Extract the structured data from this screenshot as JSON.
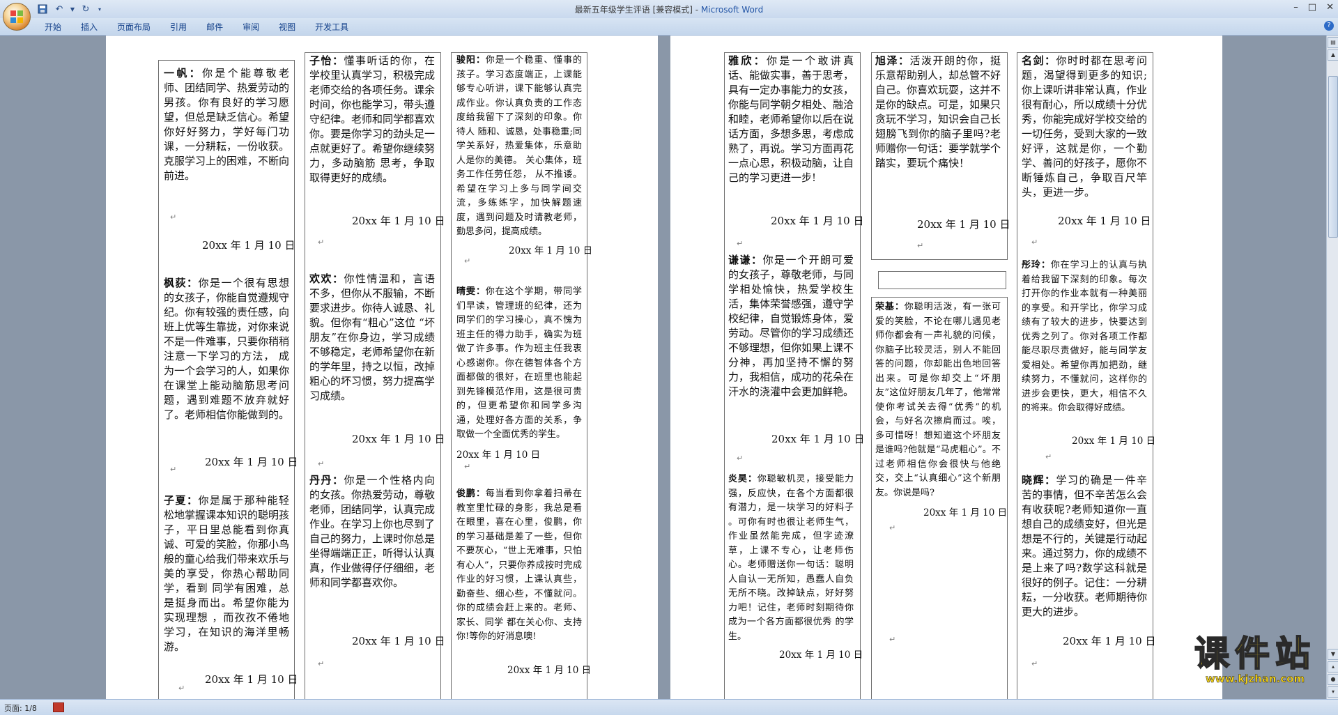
{
  "window": {
    "doc_title": "最新五年级学生评语 [兼容模式] - ",
    "app_name": "Microsoft Word"
  },
  "ribbon": {
    "tabs": [
      "开始",
      "插入",
      "页面布局",
      "引用",
      "邮件",
      "审阅",
      "视图",
      "开发工具"
    ]
  },
  "status": {
    "page": "页面: 1/8"
  },
  "watermark": {
    "text": "课件站",
    "url": "www.kjzhan.com"
  },
  "entries": {
    "yifan": {
      "name": "一帆：",
      "text": "你是个能尊敬老师、团结同学、热爱劳动的男孩。你有良好的学习愿望，但总是缺乏信心。希望你好好努力，学好每门功课，一分耕耘，一份收获。克服学习上的困难，不断向前进。",
      "date": "20xx 年 1 月 10 日"
    },
    "fengrong": {
      "name": "枫荻：",
      "text": "你是一个很有思想的女孩子，你能自觉遵规守纪。你有较强的责任感，向班上优等生靠拢，对你来说不是一件难事，只要你稍稍注意一下学习的方法， 成为一个会学习的人，如果你在课堂上能动脑筋思考问题，遇到难题不放弃就好了。老师相信你能做到的。",
      "date": "20xx 年 1 月 10 日"
    },
    "zixia": {
      "name": "子夏：",
      "text": "你是属于那种能轻松地掌握课本知识的聪明孩子，平日里总能看到你真诚、可爱的笑脸，你那小鸟般的童心给我们带来欢乐与美的享受，你热心帮助同学，看到 同学有困难，总是挺身而出。希望你能为 实现理想 ，而孜孜不倦地学习，在知识的海洋里畅游。",
      "date": "20xx 年 1 月 10 日"
    },
    "ziyi": {
      "name": "子怡：",
      "text": "懂事听话的你，在学校里认真学习，积极完成老师交给的各项任务。课余时间，你也能学习，带头遵守纪律。老师和同学都喜欢你。要是你学习的劲头足一点就更好了。希望你继续努力，多动脑筋 思考，争取取得更好的成绩。",
      "date": "20xx 年 1 月 10 日"
    },
    "huanhuan": {
      "name": "欢欢：",
      "text": "你性情温和，言语不多，但你从不服输，不断 要求进步。你待人诚恳、礼貌。但你有“粗心”这位 “坏朋友”在你身边，学习成绩不够稳定，老师希望你在新的学年里，持之以恒，改掉粗心的坏习惯，努力提高学习成绩。",
      "date": "20xx 年 1 月 10 日"
    },
    "dandan": {
      "name": "丹丹：",
      "text": "你是一个性格内向的女孩。你热爱劳动，尊敬老师，团结同学，认真完成作业。在学习上你也尽到了自己的努力，上课时你总是坐得端端正正，听得认认真真，作业做得仔仔细细，老师和同学都喜欢你。",
      "date": "20xx 年 1 月 10 日"
    },
    "junyang": {
      "name": "骏阳：",
      "text": "你是一个稳重、懂事的孩子。学习态度端正，上课能够专心听讲，课下能够认真完成作业。你认真负责的工作态度给我留下了深刻的印象。你待人 随和、诚恳，处事稳重;同学关系好，热爱集体，乐意助人是你的美德。 关心集体，班务工作任劳任怨， 从不推诿。希望在学习上多与同学间交流，多练练字，加快解题速度，遇到问题及时请教老师，勤思多问，提高成绩。",
      "date": "20xx 年 1 月 10 日"
    },
    "qingwen": {
      "name": "晴雯：",
      "text": "你在这个学期，带同学们早读，管理班的纪律，还为同学们的学习操心，真不愧为班主任的得力助手，确实为班做了许多事。作为班主任我衷心感谢你。你在德智体各个方面都做的很好，在班里也能起到先锋模范作用，这是很可贵的，但更希望你和同学多沟通，处理好各方面的关系，争取做一个全面优秀的学生。",
      "date": "20xx 年 1 月 10 日"
    },
    "junpeng": {
      "name": "俊鹏：",
      "text": "每当看到你拿着扫帚在教室里忙碌的身影，我总是看在眼里，喜在心里，俊鹏，你的学习基础是差了一些，但你不要灰心，“世上无难事，只怕有心人”，只要你养成按时完成作业的好习惯，上课认真些，勤奋些、细心些，不懂就问。你的成绩会赶上来的。老师、家长、同学 都在关心你、支持你!等你的好消息噢!",
      "date": "20xx 年 1 月 10 日"
    },
    "yaxin": {
      "name": "雅欣：",
      "text": "你是一个敢讲真话、能做实事，善于思考，具有一定办事能力的女孩，你能与同学朝夕相处、融洽和睦，老师希望你以后在说话方面，多想多思，考虑成熟了，再说。学习方面再花一点心思，积极动脑，让自己的学习更进一步!",
      "date": "20xx 年 1 月 10 日"
    },
    "qianqian": {
      "name": "谦谦：",
      "text": "你是一个开朗可爱的女孩子，尊敬老师，与同学相处愉快，热爱学校生活，集体荣誉感强，遵守学校纪律，自觉锻炼身体，爱劳动。尽管你的学习成绩还不够理想，但你如果上课不分神，再加坚持不懈的努力，我相信，成功的花朵在汗水的浇灌中会更加鲜艳。",
      "date": "20xx 年 1 月 10 日"
    },
    "yanhao": {
      "name": "炎昊：",
      "text": "你聪敏机灵，接受能力强，反应快，在各个方面都很有潜力，是一块学习的好料子 。可你有时也很让老师生气，作业虽然能完成，但字迹潦草，上课不专心，让老师伤心。老师赠送你一句话：聪明人自认一无所知，愚蠢人自负无所不晓。改掉缺点，好好努力吧！记住，老师时刻期待你 成为一个各方面都很优秀 的学生。",
      "date": "20xx 年 1 月 10 日"
    },
    "xuze": {
      "name": "旭泽：",
      "text": "活泼开朗的你，挺乐意帮助别人，却总管不好自己。你喜欢玩耍，这并不是你的缺点。可是，如果只贪玩不学习，知识会自己长翅膀飞到你的脑子里吗?老师赠你一句话：要学就学个踏实，要玩个痛快！",
      "date": "20xx 年 1 月 10 日"
    },
    "rongji": {
      "name": "荣基：",
      "text": "你聪明活泼，有一张可爱的笑脸，不论在哪儿遇见老师你都会有一声礼貌的问候，你脑子比较灵活，别人不能回答的问题，你却能出色地回答出来。可是你却交上“坏朋友”这位好朋友几年了，他常常使你考试关去得“优秀”的机会，与好名次擦肩而过。唉，多可惜呀！想知道这个坏朋友是谁吗?他就是“马虎粗心”。不过老师相信你会很快与他绝交，交上“认真细心”这个新朋友。你说是吗?",
      "date": "20xx 年 1 月 10 日"
    },
    "mingjian": {
      "name": "名剑：",
      "text": "你时时都在思考问题，渴望得到更多的知识;你上课听讲非常认真，作业很有耐心，所以成绩十分优秀，你能完成好学校交给的一切任务，受到大家的一致好评，这就是你，一个勤学、善问的好孩子，愿你不断锤炼自己，争取百尺竿头，更进一步。",
      "date": "20xx 年 1 月 10 日"
    },
    "tongling": {
      "name": "彤玲：",
      "text": "你在学习上的认真与执着给我留下深刻的印象。每次打开你的作业本就有一种美丽的享受。和开学比，你学习成绩有了较大的进步，快要达到优秀之列了。你对各项工作都能尽职尽责做好，能与同学友爱相处。希望你再加把劲，继续努力，不懂就问，这样你的进步会更快，更大，相信不久的将来。你会取得好成绩。",
      "date": "20xx 年 1 月 10 日"
    },
    "xiaohui": {
      "name": "晓辉：",
      "text": "学习的确是一件辛苦的事情，但不辛苦怎么会有收获呢?老师知道你一直想自己的成绩变好，但光是想是不行的，关键是行动起来。通过努力，你的成绩不是上来了吗?数学这科就是很好的例子。记住：一分耕耘，一分收获。老师期待你更大的进步。",
      "date": "20xx 年 1 月 10 日"
    }
  }
}
